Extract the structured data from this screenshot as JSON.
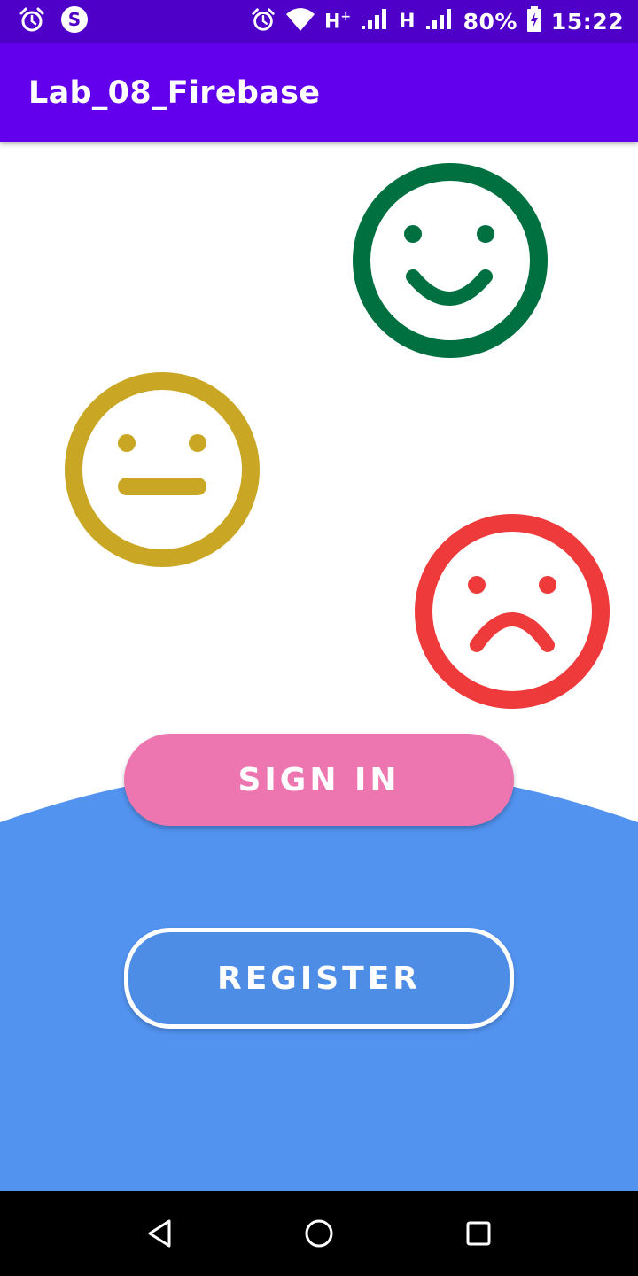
{
  "status_bar": {
    "network_type_1": "H",
    "network_type_1_suffix": "+",
    "network_type_2": "H",
    "battery_percent": "80%",
    "time": "15:22",
    "icons": [
      "alarm-icon",
      "s-app-icon",
      "alarm-icon",
      "wifi-icon",
      "signal-icon",
      "signal-icon",
      "battery-charging-icon"
    ]
  },
  "app_bar": {
    "title": "Lab_08_Firebase"
  },
  "faces": [
    {
      "mood": "happy",
      "color": "#007040"
    },
    {
      "mood": "neutral",
      "color": "#c9a724"
    },
    {
      "mood": "sad",
      "color": "#ee3a3a"
    }
  ],
  "buttons": {
    "sign_in": {
      "label": "SIGN IN",
      "color": "#ee76b0"
    },
    "register": {
      "label": "REGISTER",
      "color": "#4e8de6"
    }
  },
  "background": {
    "arc_color": "#5293f0",
    "primary_color": "#6200ee",
    "status_color": "#4f00c8"
  },
  "nav_bar": {
    "icons": [
      "back-icon",
      "home-icon",
      "recents-icon"
    ]
  }
}
